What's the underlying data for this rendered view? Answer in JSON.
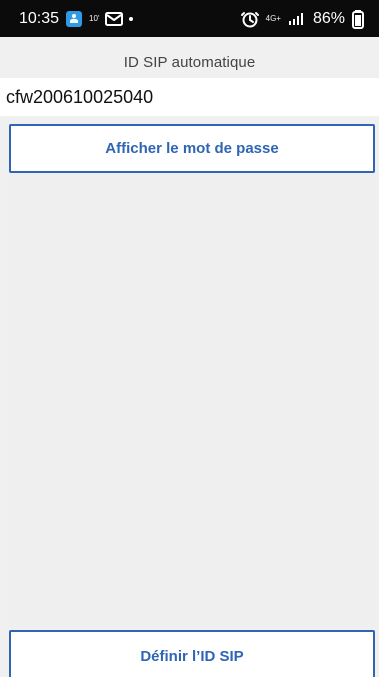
{
  "status_bar": {
    "time": "10:35",
    "mini_text": "10'",
    "network_label": "4G+",
    "battery_text": "86%"
  },
  "screen": {
    "title": "ID SIP automatique",
    "sip_id": "cfw200610025040",
    "show_password_label": "Afficher le mot de passe",
    "define_sip_label": "Définir l’ID SIP"
  }
}
